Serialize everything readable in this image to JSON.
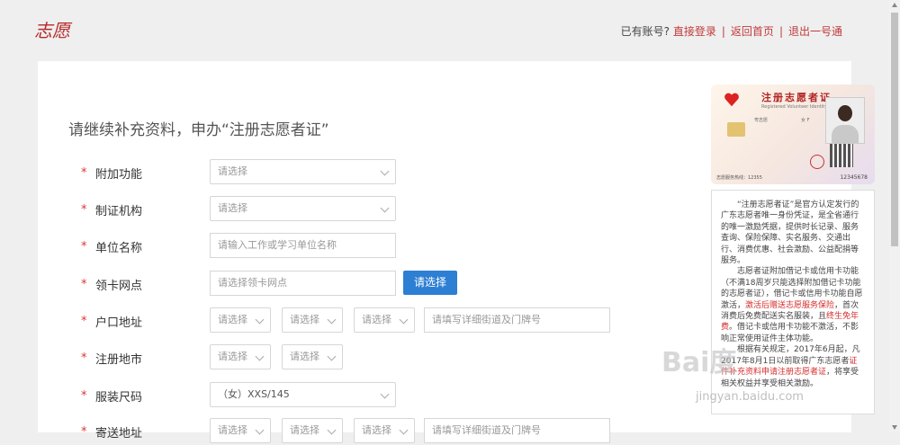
{
  "header": {
    "logo_text": "志愿",
    "account_prompt": "已有账号?",
    "links": [
      "直接登录",
      "返回首页",
      "退出一号通"
    ]
  },
  "form": {
    "heading": "请继续补充资料，申办“注册志愿者证”",
    "required_mark": "*",
    "rows": [
      {
        "label": "附加功能",
        "select": "请选择"
      },
      {
        "label": "制证机构",
        "select": "请选择"
      },
      {
        "label": "单位名称",
        "input_placeholder": "请输入工作或学习单位名称"
      },
      {
        "label": "领卡网点",
        "input_placeholder": "请选择领卡网点",
        "button": "请选择"
      },
      {
        "label": "户口地址",
        "selects": [
          "请选择",
          "请选择",
          "请选择"
        ],
        "input_placeholder": "请填写详细街道及门牌号"
      },
      {
        "label": "注册地市",
        "selects": [
          "请选择",
          "请选择"
        ]
      },
      {
        "label": "服装尺码",
        "select": "（女）XXS/145"
      },
      {
        "label": "寄送地址",
        "selects": [
          "请选择",
          "请选择",
          "请选择"
        ],
        "input_placeholder": "请填写详细街道及门牌号"
      }
    ]
  },
  "card": {
    "title": "注册志愿者证",
    "subtitle": "Registered Volunteer Identity Card",
    "name": "粤志愿",
    "gender": "女 F",
    "number": "12345678",
    "hotline": "志愿服务热线：12355"
  },
  "description": {
    "p1": "“注册志愿者证”是官方认定发行的广东志愿者唯一身份凭证，是全省通行的唯一激励凭据，提供时长记录、服务查询、保险保障、实名服务、交通出行、消费优惠、社会激励、公益配捐等服务。",
    "p2a": "志愿者证附加借记卡或信用卡功能（不满18周岁只能选择附加借记卡功能的志愿者证），借记卡或信用卡功能自愿激活，",
    "p2b": "激活后赠送志愿服务保险",
    "p2c": "，首次消费后免费配送实名服装，且",
    "p2d": "终生免年费",
    "p2e": "。借记卡或信用卡功能不激活，不影响正常使用证件主体功能。",
    "p3a": "根据有关规定，2017年6月起，凡2017年8月1日以前取得广东志愿者",
    "p3b": "证件补充资料申请注册志愿者证",
    "p3c": "，将享受相关权益并享受相关激励。"
  },
  "watermark": {
    "text": "Bai度",
    "sub": "jingyan.baidu.com"
  }
}
